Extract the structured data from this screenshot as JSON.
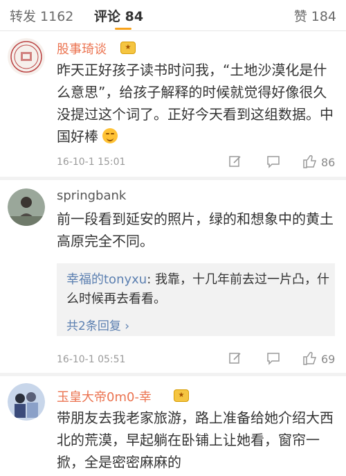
{
  "tabs": {
    "repost": "转发 1162",
    "comment": "评论 84",
    "like": "赞 184"
  },
  "comments": [
    {
      "username": "股事琦谈",
      "text_part1": "昨天正好孩子读书时问我，“土地沙漠化是什么意思”，给孩子解释的时候就觉得好像很久没提过这个词了。正好今天看到这组数据。中国好棒",
      "timestamp": "16-10-1 15:01",
      "likes": "86"
    },
    {
      "username": "springbank",
      "text": "前一段看到延安的照片，绿的和想象中的黄土高原完全不同。",
      "reply_name": "幸福的tonyxu",
      "reply_text": ": 我靠，十几年前去过一片凸，什么时候再去看看。",
      "reply_more": "共2条回复 ›",
      "timestamp": "16-10-1 05:51",
      "likes": "69"
    },
    {
      "username": "玉皇大帝0m0-幸",
      "text": "带朋友去我老家旅游，路上准备给她介绍大西北的荒漠，早起躺在卧铺上让她看，窗帘一掀，全是密密麻麻的"
    }
  ],
  "icons": {
    "vip": "vip-badge-icon",
    "emoji": "smile-emoji-icon",
    "edit": "edit-icon",
    "chat": "chat-bubble-icon",
    "thumb": "thumbs-up-icon"
  }
}
